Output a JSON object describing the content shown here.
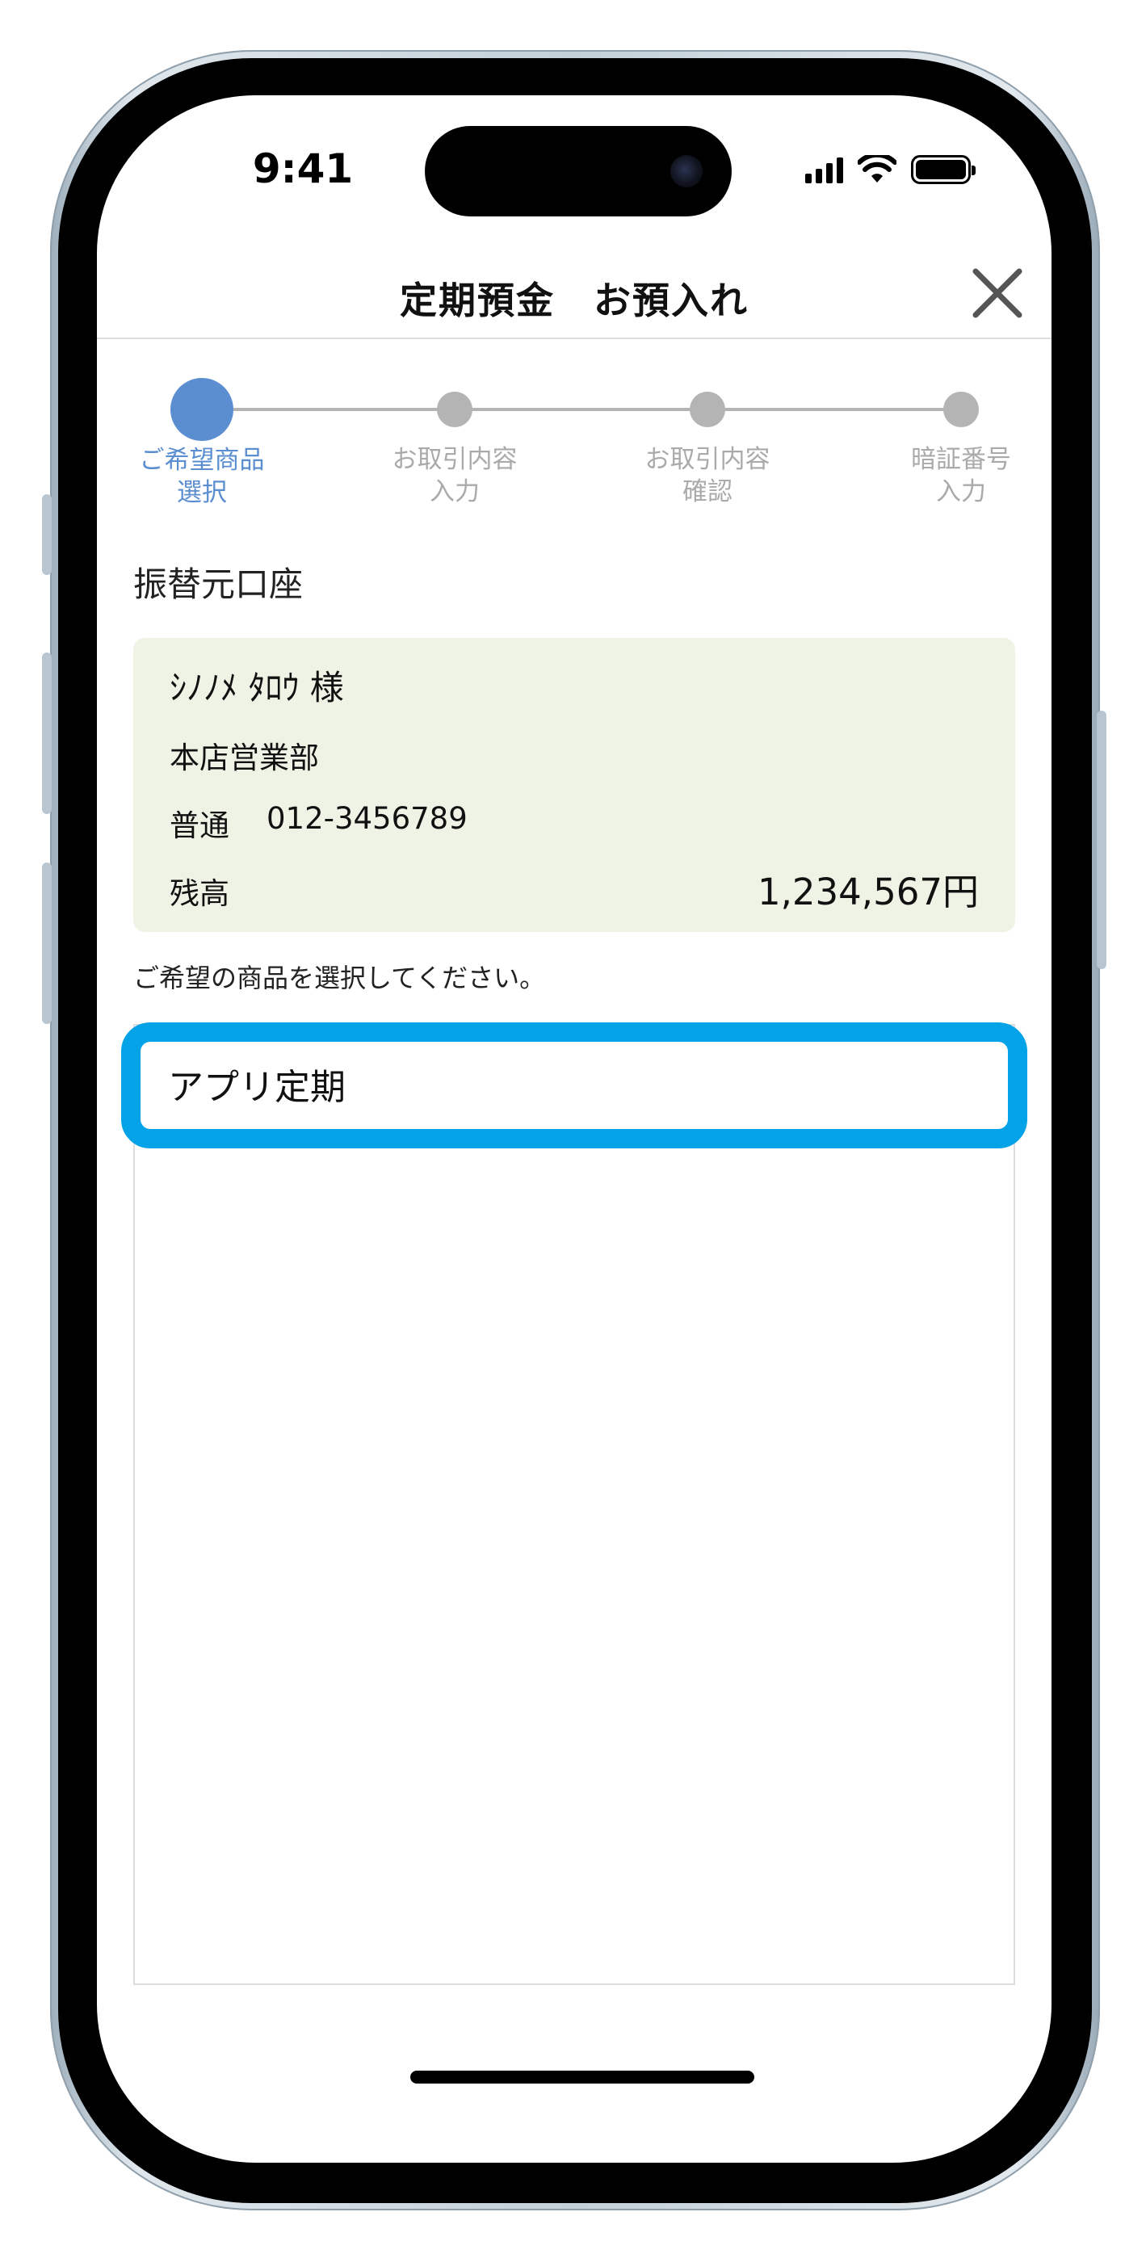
{
  "status_bar": {
    "time": "9:41"
  },
  "header": {
    "title": "定期預金　お預入れ"
  },
  "stepper": {
    "steps": [
      {
        "label": "ご希望商品\n選択",
        "active": true
      },
      {
        "label": "お取引内容\n入力",
        "active": false
      },
      {
        "label": "お取引内容\n確認",
        "active": false
      },
      {
        "label": "暗証番号\n入力",
        "active": false
      }
    ]
  },
  "source_account": {
    "title": "振替元口座",
    "holder": "ｼﾉﾉﾒ ﾀﾛｳ 様",
    "branch": "本店営業部",
    "account_type": "普通",
    "account_number": "012-3456789",
    "balance_label": "残高",
    "balance": "1,234,567円"
  },
  "product_selection": {
    "instruction": "ご希望の商品を選択してください。",
    "items": [
      {
        "label": "アプリ定期"
      }
    ]
  },
  "colors": {
    "accent": "#5b8ed1",
    "highlight": "#04a2e6",
    "card_background": "#eff3e5",
    "inactive": "#b4b4b4"
  }
}
